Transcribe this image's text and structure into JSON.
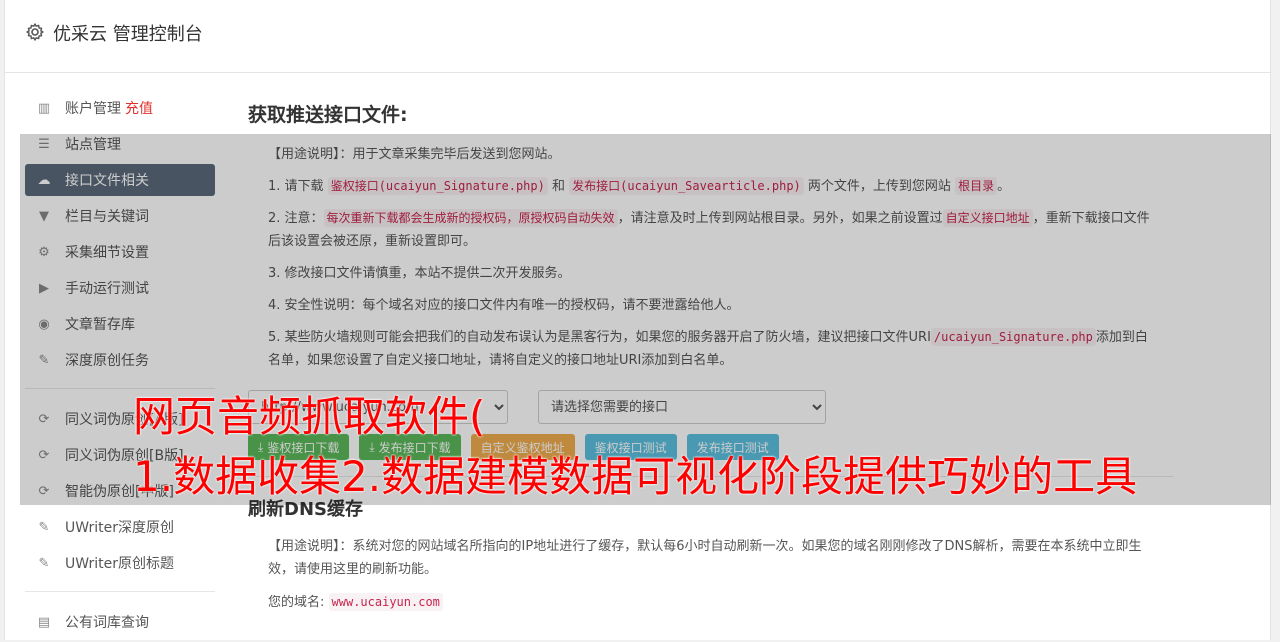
{
  "header": {
    "title": "优采云 管理控制台",
    "icon": "gear-icon"
  },
  "sidebar": {
    "items": [
      {
        "label": "账户管理",
        "badge": "充值",
        "icon": "bar-chart-icon"
      },
      {
        "label": "站点管理",
        "icon": "server-icon"
      },
      {
        "label": "接口文件相关",
        "icon": "cloud-upload-icon"
      },
      {
        "label": "栏目与关键词",
        "icon": "filter-icon"
      },
      {
        "label": "采集细节设置",
        "icon": "gears-icon"
      },
      {
        "label": "手动运行测试",
        "icon": "play-circle-icon"
      },
      {
        "label": "文章暂存库",
        "icon": "database-icon"
      },
      {
        "label": "深度原创任务",
        "icon": "edit-icon"
      }
    ],
    "items2": [
      {
        "label": "同义词伪原创[A版]",
        "icon": "refresh-icon"
      },
      {
        "label": "同义词伪原创[B版]",
        "icon": "refresh-icon"
      },
      {
        "label": "智能伪原创[中版]",
        "icon": "refresh-icon"
      },
      {
        "label": "UWriter深度原创",
        "icon": "edit-icon"
      },
      {
        "label": "UWriter原创标题",
        "icon": "edit-icon"
      }
    ],
    "items3": [
      {
        "label": "公有词库查询",
        "icon": "book-icon"
      }
    ]
  },
  "main": {
    "section1": {
      "title": "获取推送接口文件:",
      "usage_label": "【用途说明】",
      "usage_text": "：用于文章采集完毕后发送到您网站。",
      "p1_a": "1. 请下载",
      "p1_code1": "鉴权接口(ucaiyun_Signature.php)",
      "p1_b": "和",
      "p1_code2": "发布接口(ucaiyun_Savearticle.php)",
      "p1_c": "两个文件，上传到您网站",
      "p1_code3": "根目录",
      "p1_d": "。",
      "p2_a": "2. 注意：",
      "p2_code1": "每次重新下载都会生成新的授权码，原授权码自动失效",
      "p2_b": "，请注意及时上传到网站根目录。另外，如果之前设置过",
      "p2_code2": "自定义接口地址",
      "p2_c": "，重新下载接口文件后该设置会被还原，重新设置即可。",
      "p3": "3. 修改接口文件请慎重，本站不提供二次开发服务。",
      "p4": "4. 安全性说明：每个域名对应的接口文件内有唯一的授权码，请不要泄露给他人。",
      "p5_a": "5. 某些防火墙规则可能会把我们的自动发布误认为是黑客行为，如果您的服务器开启了防火墙，建议把接口文件URI",
      "p5_code": "/ucaiyun_Signature.php",
      "p5_b": "添加到白名单，如果您设置了自定义接口地址，请将自定义的接口地址URI添加到白名单。",
      "select_site": "http://www.ucaiyun.com",
      "select_api": "请选择您需要的接口",
      "buttons": {
        "download_sign": "鉴权接口下载",
        "download_publish": "发布接口下载",
        "custom_sign_url": "自定义鉴权地址",
        "test_sign": "鉴权接口测试",
        "test_publish": "发布接口测试"
      }
    },
    "section2": {
      "title": "刷新DNS缓存",
      "usage_label": "【用途说明】",
      "usage_text": "：系统对您的网站域名所指向的IP地址进行了缓存，默认每6小时自动刷新一次。如果您的域名刚刚修改了DNS解析，需要在本系统中立即生效，请使用这里的刷新功能。",
      "domain_label": "您的域名:",
      "domain_value": "www.ucaiyun.com"
    }
  },
  "watermark": {
    "line1": "网页音频抓取软件(",
    "line2": "1.数据收集2.数据建模数据可视化阶段提供巧妙的工具",
    "color": "#ff0000"
  }
}
